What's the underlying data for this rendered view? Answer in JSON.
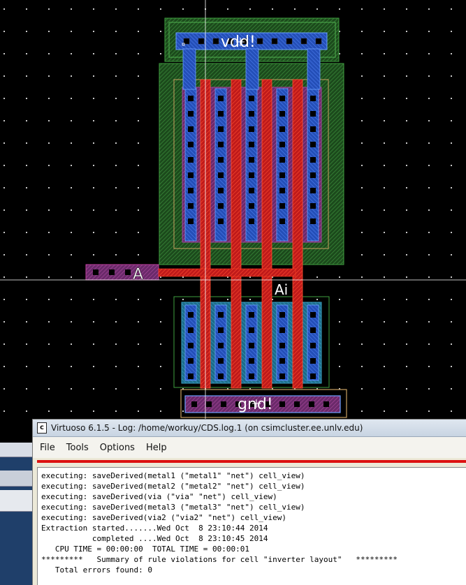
{
  "layout_canvas": {
    "labels": {
      "vdd": "vdd!",
      "gnd": "gnd!",
      "input": "A",
      "output": "Ai"
    }
  },
  "log_window": {
    "title": "Virtuoso 6.1.5 - Log: /home/workuy/CDS.log.1 (on csimcluster.ee.unlv.edu)",
    "app_icon": "c",
    "menu": {
      "file": "File",
      "tools": "Tools",
      "options": "Options",
      "help": "Help"
    },
    "lines": [
      "executing: saveDerived(metal1 (\"metal1\" \"net\") cell_view)",
      "executing: saveDerived(metal2 (\"metal2\" \"net\") cell_view)",
      "executing: saveDerived(via (\"via\" \"net\") cell_view)",
      "executing: saveDerived(metal3 (\"metal3\" \"net\") cell_view)",
      "executing: saveDerived(via2 (\"via2\" \"net\") cell_view)",
      "Extraction started.......Wed Oct  8 23:10:44 2014",
      "           completed ....Wed Oct  8 23:10:45 2014",
      "   CPU TIME = 00:00:00  TOTAL TIME = 00:00:01",
      "*********   Summary of rule violations for cell \"inverter layout\"   *********",
      "   Total errors found: 0"
    ]
  },
  "colors": {
    "background": "#000000",
    "nwell": "#2f7a2f",
    "metal1": "#2a5bd6",
    "poly": "#e02020",
    "contact": "#000000",
    "select": "#c8a060",
    "accent_red": "#d11111"
  }
}
